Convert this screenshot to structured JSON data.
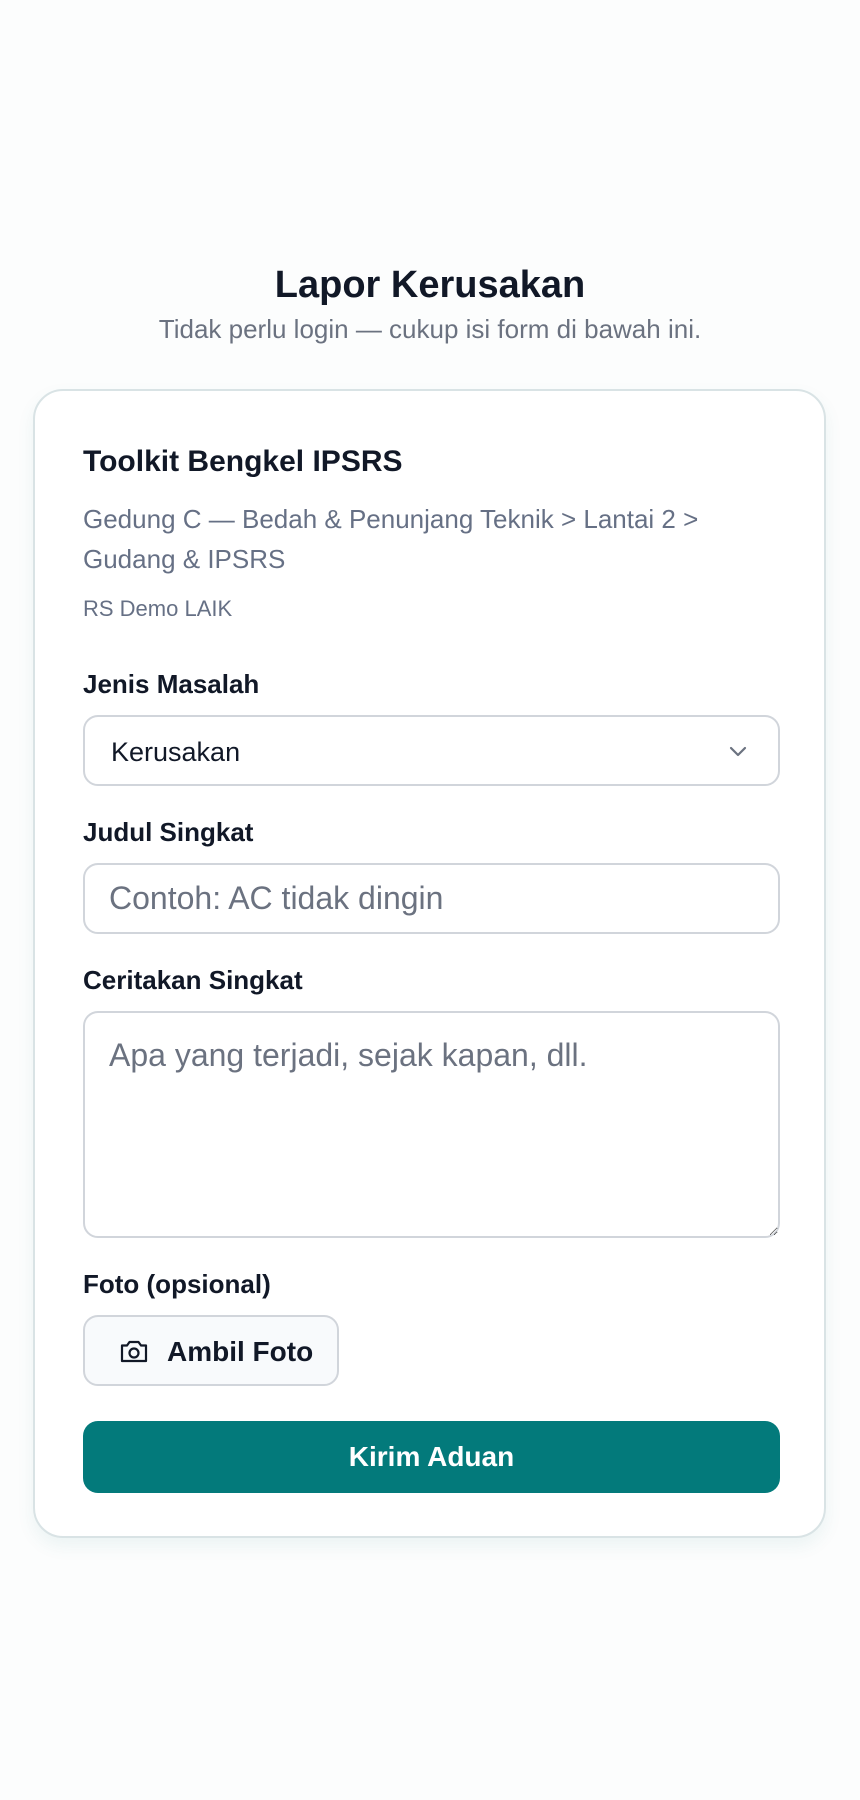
{
  "header": {
    "title": "Lapor Kerusakan",
    "subtitle": "Tidak perlu login — cukup isi form di bawah ini."
  },
  "asset": {
    "name": "Toolkit Bengkel IPSRS",
    "location": "Gedung C — Bedah & Penunjang Teknik > Lantai 2 > Gudang & IPSRS",
    "organization": "RS Demo LAIK"
  },
  "form": {
    "issue_type": {
      "label": "Jenis Masalah",
      "selected": "Kerusakan",
      "icon": "chevron-down-icon"
    },
    "short_title": {
      "label": "Judul Singkat",
      "value": "",
      "placeholder": "Contoh: AC tidak dingin"
    },
    "description": {
      "label": "Ceritakan Singkat",
      "value": "",
      "placeholder": "Apa yang terjadi, sejak kapan, dll."
    },
    "photo": {
      "label": "Foto (opsional)",
      "button_label": "Ambil Foto",
      "icon": "camera-icon"
    },
    "submit_label": "Kirim Aduan"
  },
  "colors": {
    "background": "#fcfdfd",
    "card_border": "#d9e3e5",
    "primary": "#037a7b",
    "text": "#111827",
    "muted_text": "#667085",
    "input_border": "#d1d5db"
  }
}
